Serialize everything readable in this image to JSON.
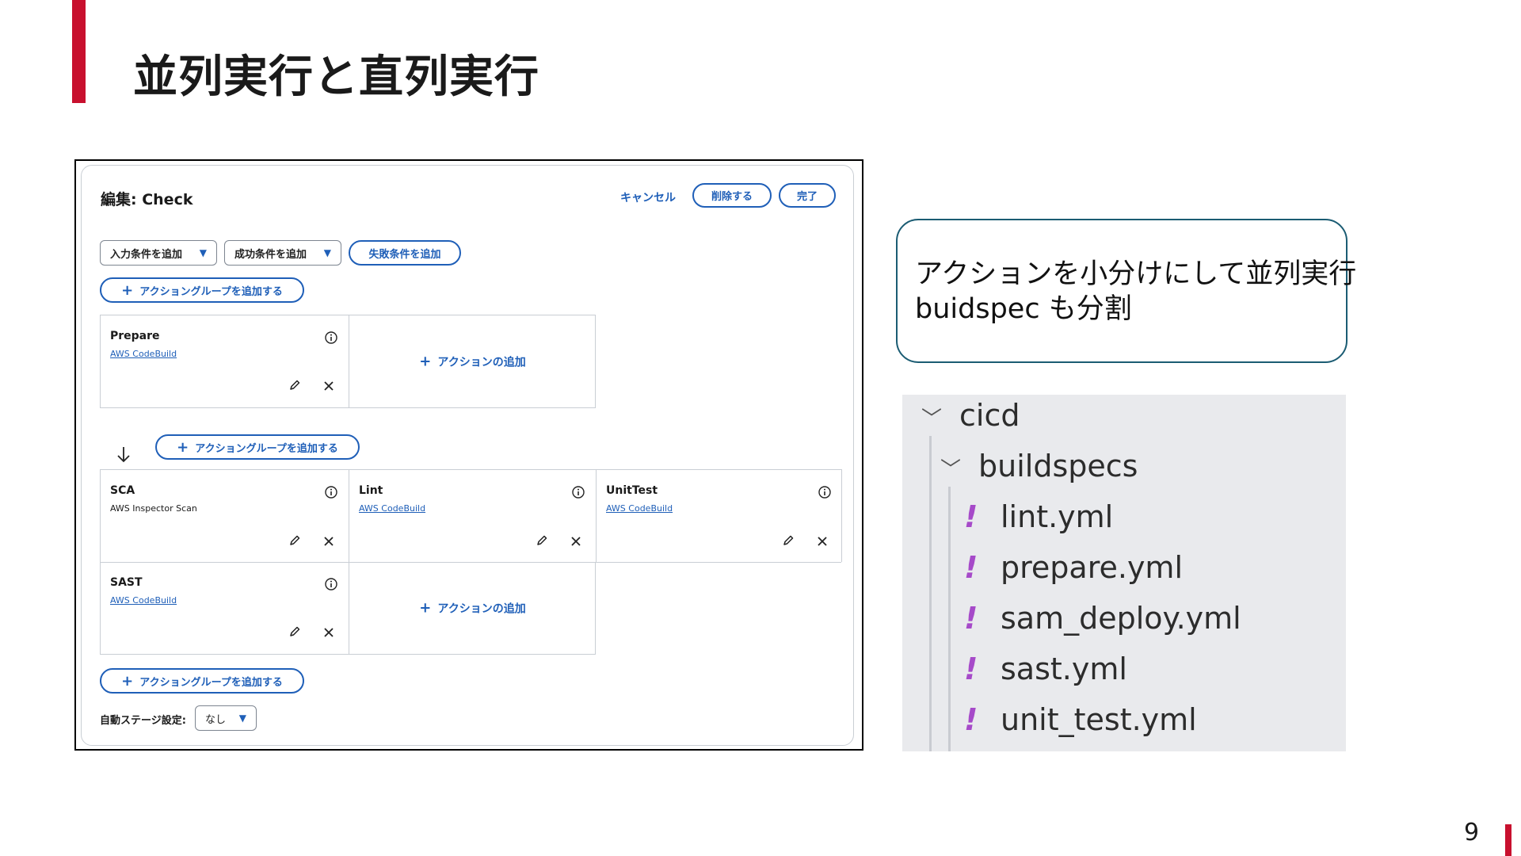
{
  "slide": {
    "title": "並列実行と直列実行",
    "page_number": "9",
    "accent_color": "#c8102e"
  },
  "editor": {
    "title": "編集: Check",
    "cancel_label": "キャンセル",
    "delete_label": "削除する",
    "done_label": "完了",
    "input_condition_label": "入力条件を追加",
    "success_condition_label": "成功条件を追加",
    "failure_condition_label": "失敗条件を追加",
    "add_group_label": "アクショングループを追加する",
    "add_action_label": "アクションの追加",
    "auto_stage_label": "自動ステージ設定:",
    "auto_stage_value": "なし",
    "groups": [
      {
        "actions": [
          {
            "name": "Prepare",
            "provider": "AWS CodeBuild"
          }
        ]
      },
      {
        "actions": [
          {
            "name": "SCA",
            "provider": "AWS Inspector Scan"
          },
          {
            "name": "Lint",
            "provider": "AWS CodeBuild"
          },
          {
            "name": "UnitTest",
            "provider": "AWS CodeBuild"
          },
          {
            "name": "SAST",
            "provider": "AWS CodeBuild"
          }
        ]
      }
    ],
    "accent_color": "#1f5fb8"
  },
  "callout": {
    "line1": "アクションを小分けにして並列実行",
    "line2": "buidspec も分割"
  },
  "file_tree": {
    "root": "cicd",
    "folder": "buildspecs",
    "files": [
      "lint.yml",
      "prepare.yml",
      "sam_deploy.yml",
      "sast.yml",
      "unit_test.yml"
    ],
    "file_icon": "exclamation-icon",
    "file_icon_color": "#a64ac9"
  }
}
